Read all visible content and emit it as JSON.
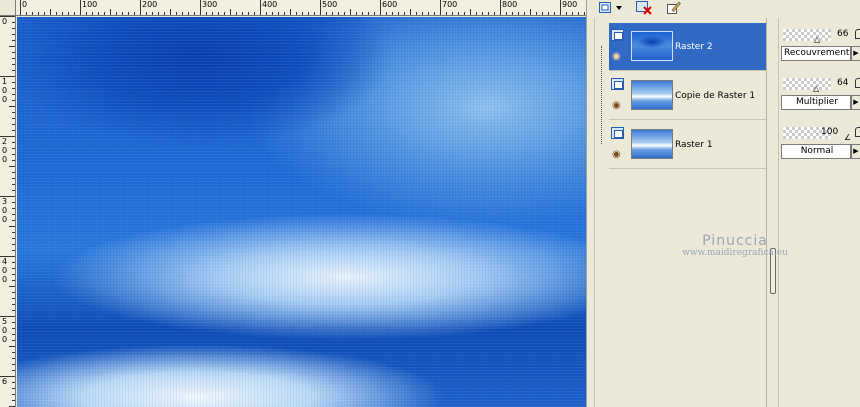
{
  "rulers": {
    "horizontal_labels": [
      "0",
      "100",
      "200",
      "300",
      "400",
      "500",
      "600",
      "700",
      "800",
      "900"
    ],
    "vertical_labels": [
      "0",
      "1\n0\n0",
      "2\n0\n0",
      "3\n0\n0",
      "4\n0\n0",
      "5\n0\n0",
      "6"
    ]
  },
  "layers": [
    {
      "name": "Raster 2",
      "selected": true,
      "opacity": "66",
      "blend_mode": "Recouvrement"
    },
    {
      "name": "Copie de Raster 1",
      "selected": false,
      "opacity": "64",
      "blend_mode": "Multiplier"
    },
    {
      "name": "Raster 1",
      "selected": false,
      "opacity": "100",
      "blend_mode": "Normal"
    }
  ],
  "toolbar": {
    "icons": [
      "new-layer-icon",
      "dropdown-arrow-icon",
      "delete-layer-icon",
      "edit-icon"
    ]
  },
  "watermark": {
    "name": "Pinuccia",
    "url": "www.maidiregrafica.eu"
  },
  "colors": {
    "selection": "#316ac5",
    "panel": "#ece9d8"
  }
}
